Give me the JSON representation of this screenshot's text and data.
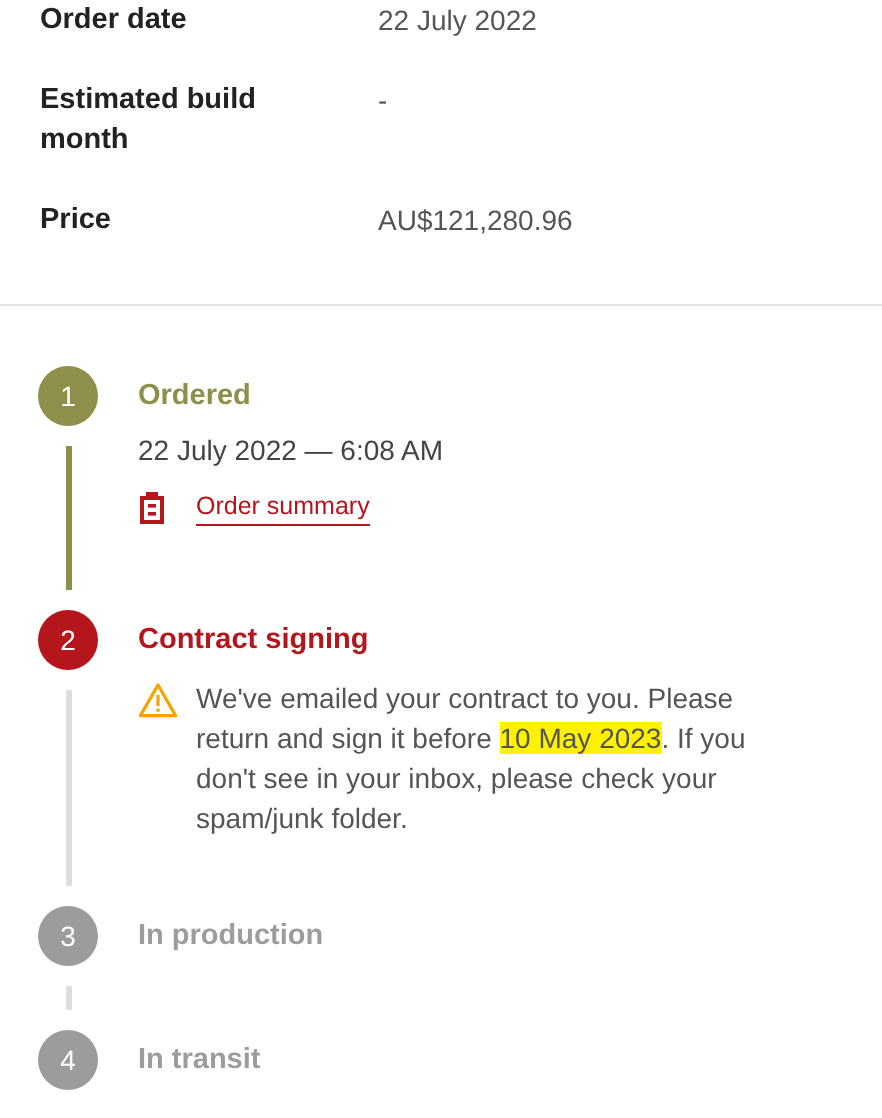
{
  "details": [
    {
      "label": "Order date",
      "value": "22 July 2022"
    },
    {
      "label": "Estimated build month",
      "value": "-"
    },
    {
      "label": "Price",
      "value": "AU$121,280.96"
    }
  ],
  "steps": [
    {
      "number": "1",
      "title": "Ordered",
      "kind": "completed",
      "datetime": "22 July 2022 — 6:08 AM",
      "link": "Order summary"
    },
    {
      "number": "2",
      "title": "Contract signing",
      "kind": "current",
      "message": [
        {
          "text": "We've emailed your contract to you. Please return and sign it before ",
          "highlighted": false
        },
        {
          "text": "10 May 2023",
          "highlighted": true
        },
        {
          "text": ". If you don't see in your inbox, please check your spam/junk folder.",
          "highlighted": false
        }
      ]
    },
    {
      "number": "3",
      "title": "In production",
      "kind": "pending"
    },
    {
      "number": "4",
      "title": "In transit",
      "kind": "pending"
    }
  ]
}
